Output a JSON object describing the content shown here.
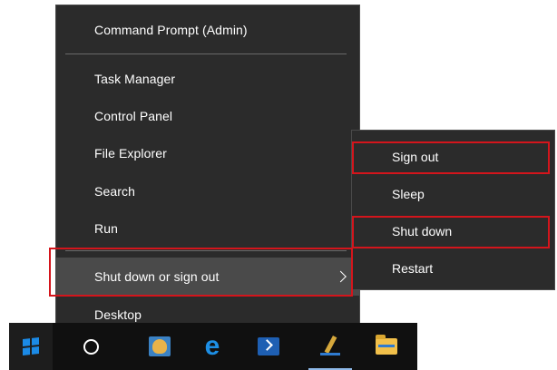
{
  "menu": {
    "items": [
      {
        "label": "Command Prompt (Admin)"
      },
      {
        "label": "Task Manager"
      },
      {
        "label": "Control Panel"
      },
      {
        "label": "File Explorer"
      },
      {
        "label": "Search"
      },
      {
        "label": "Run"
      },
      {
        "label": "Shut down or sign out"
      },
      {
        "label": "Desktop"
      }
    ]
  },
  "submenu": {
    "items": [
      {
        "label": "Sign out"
      },
      {
        "label": "Sleep"
      },
      {
        "label": "Shut down"
      },
      {
        "label": "Restart"
      }
    ]
  },
  "taskbar": {
    "icons": [
      "windows-start-icon",
      "cortana-search-icon",
      "store-icon",
      "edge-icon",
      "powershell-icon",
      "pen-app-icon",
      "file-explorer-icon"
    ]
  },
  "colors": {
    "menu_bg": "#2b2b2b",
    "hover_bg": "#4a4a4a",
    "highlight": "#d4151c",
    "taskbar_bg": "#101010",
    "accent": "#1b8ae6"
  }
}
